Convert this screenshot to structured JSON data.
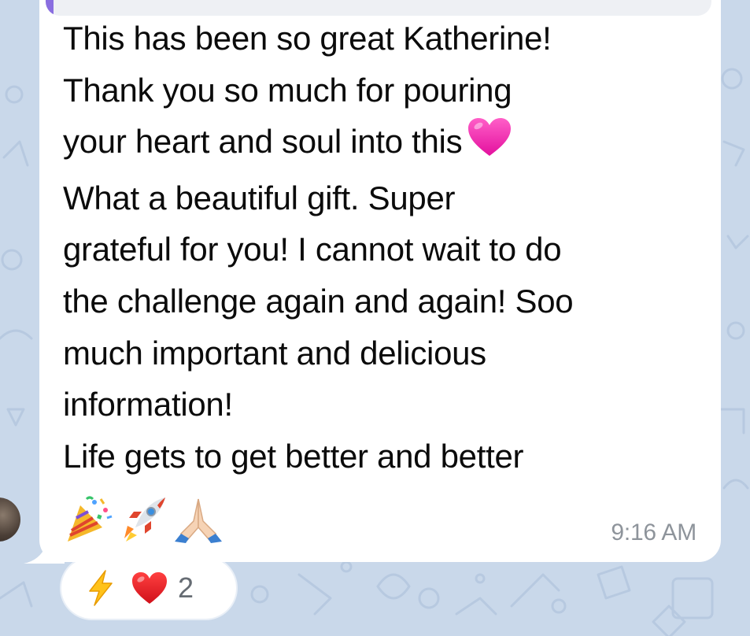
{
  "message": {
    "lines": [
      "This has been so great Katherine!",
      "Thank you so much for pouring",
      "your heart and soul into this",
      "What a beautiful gift. Super",
      "grateful for you! I cannot wait to do",
      "the challenge again and again! Soo",
      "much important and delicious",
      "information!",
      "Life gets to get better and better"
    ],
    "inline_emoji": "pink-heart",
    "trailing_emojis": [
      "party-popper",
      "rocket",
      "folded-hands"
    ],
    "timestamp": "9:16 AM"
  },
  "reactions": {
    "emojis": [
      "high-voltage",
      "red-heart"
    ],
    "count": "2"
  },
  "colors": {
    "wallpaper": "#c9d8ea",
    "bubble": "#ffffff",
    "reply_accent": "#8a6ee0",
    "text": "#0b0b0b",
    "timestamp": "#8e949b"
  }
}
